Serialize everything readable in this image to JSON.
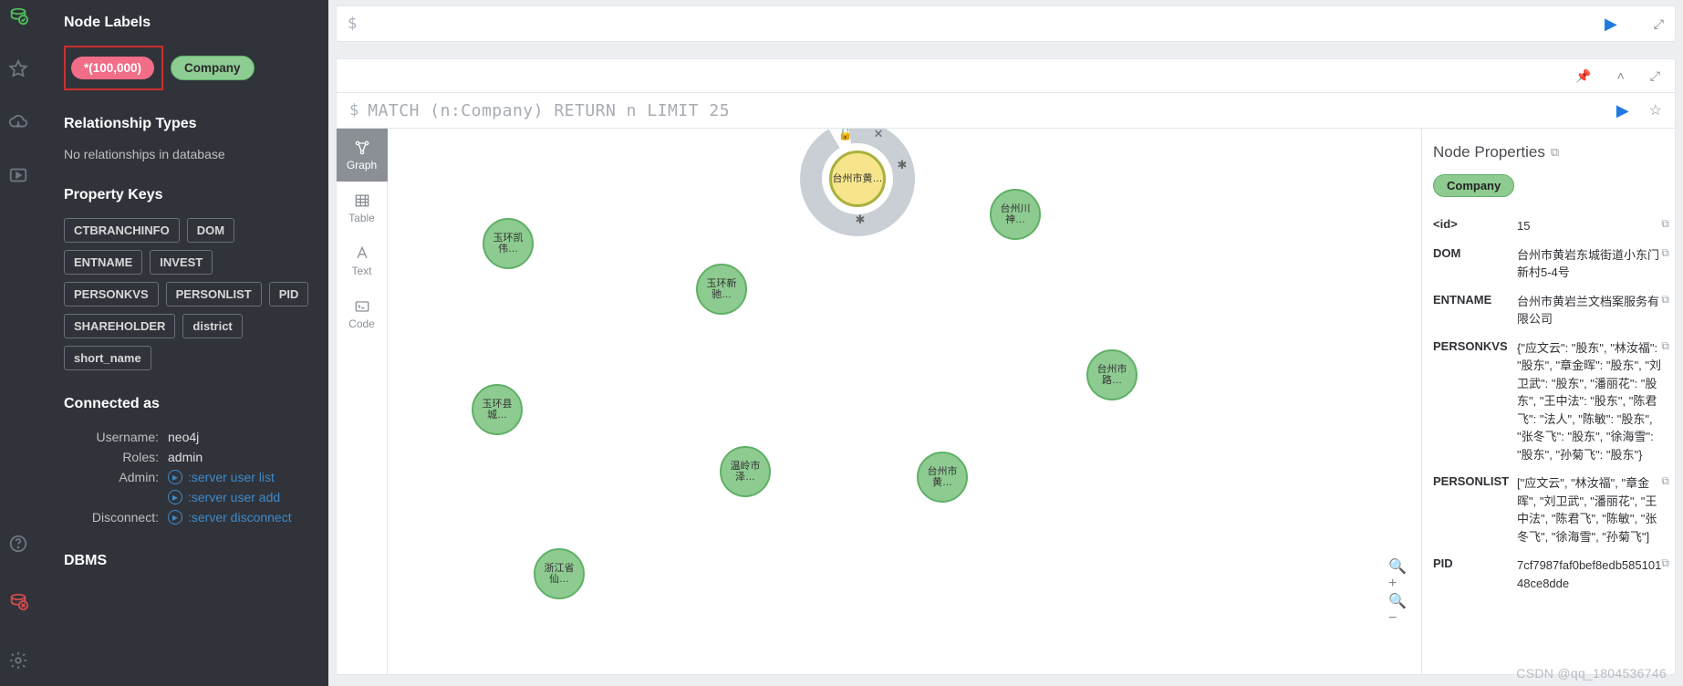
{
  "rail": {
    "items": [
      "db-ok",
      "star",
      "cloud",
      "play-rect",
      "help",
      "db-err",
      "gear"
    ]
  },
  "sidebar": {
    "labels_heading": "Node Labels",
    "all_label": "*(100,000)",
    "company_label": "Company",
    "rel_heading": "Relationship Types",
    "rel_msg": "No relationships in database",
    "keys_heading": "Property Keys",
    "keys": [
      "CTBRANCHINFO",
      "DOM",
      "ENTNAME",
      "INVEST",
      "PERSONKVS",
      "PERSONLIST",
      "PID",
      "SHAREHOLDER",
      "district",
      "short_name"
    ],
    "conn_heading": "Connected as",
    "conn_username_label": "Username:",
    "conn_username": "neo4j",
    "conn_roles_label": "Roles:",
    "conn_roles": "admin",
    "conn_admin_label": "Admin:",
    "conn_admin_links": [
      ":server user list",
      ":server user add"
    ],
    "conn_disc_label": "Disconnect:",
    "conn_disc_link": ":server disconnect",
    "dbms_heading": "DBMS"
  },
  "editor": {
    "prompt": "$"
  },
  "result": {
    "query_prompt": "$",
    "query_text": "MATCH (n:Company) RETURN n LIMIT 25",
    "viz_tabs": {
      "graph": "Graph",
      "table": "Table",
      "text": "Text",
      "code": "Code"
    },
    "nodes": [
      {
        "name": "台州市黄…",
        "highlight": true
      },
      {
        "name": "玉环凯伟…"
      },
      {
        "name": "台州川神…"
      },
      {
        "name": "玉环新驰…"
      },
      {
        "name": "玉环县城…"
      },
      {
        "name": "台州市路…"
      },
      {
        "name": "温岭市泽…"
      },
      {
        "name": "台州市黄…"
      },
      {
        "name": "浙江省仙…"
      }
    ],
    "props_title": "Node Properties",
    "props_label": "Company",
    "props": {
      "id_key": "<id>",
      "id_val": "15",
      "dom_key": "DOM",
      "dom_val": "台州市黄岩东城街道小东门新村5-4号",
      "ent_key": "ENTNAME",
      "ent_val": "台州市黄岩兰文档案服务有限公司",
      "pkvs_key": "PERSONKVS",
      "pkvs_val": "{\"应文云\": \"股东\", \"林汝福\": \"股东\", \"章金晖\": \"股东\", \"刘卫武\": \"股东\", \"潘丽花\": \"股东\", \"王中法\": \"股东\", \"陈君飞\": \"法人\", \"陈敏\": \"股东\", \"张冬飞\": \"股东\", \"徐海雪\": \"股东\", \"孙菊飞\": \"股东\"}",
      "plist_key": "PERSONLIST",
      "plist_val": "[\"应文云\", \"林汝福\", \"章金晖\", \"刘卫武\", \"潘丽花\", \"王中法\", \"陈君飞\", \"陈敏\", \"张冬飞\", \"徐海雪\", \"孙菊飞\"]",
      "pid_key": "PID",
      "pid_val": "7cf7987faf0bef8edb58510148ce8dde"
    }
  },
  "watermark": "CSDN @qq_1804536746"
}
